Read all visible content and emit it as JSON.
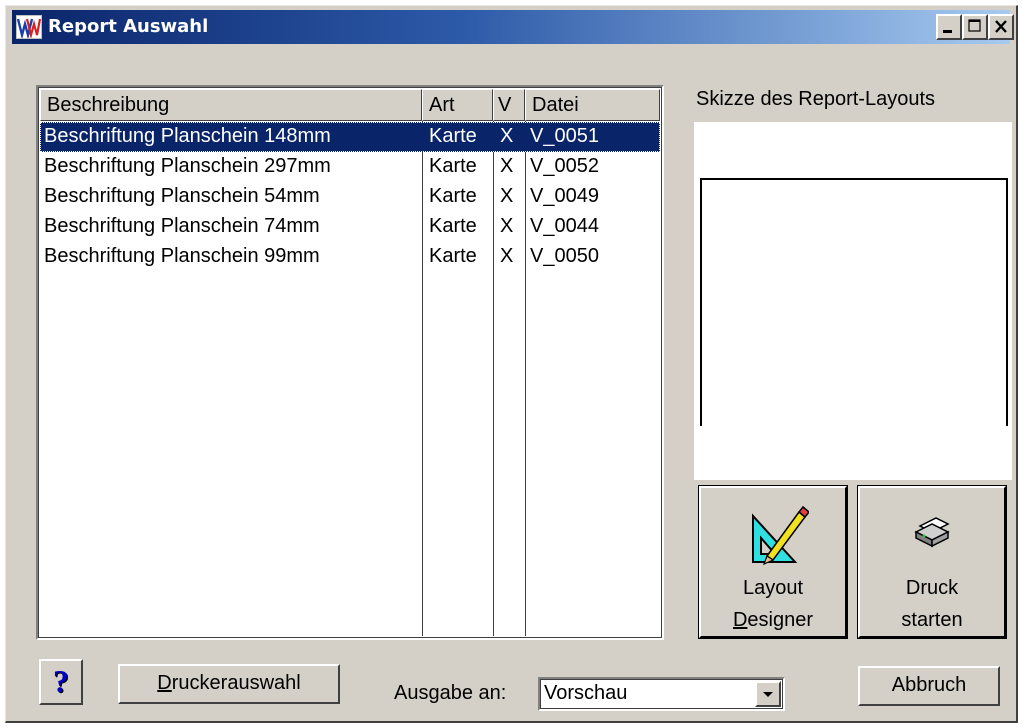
{
  "window": {
    "title": "Report Auswahl",
    "icon": "app-logo-icon",
    "controls": {
      "minimize": "minimize-icon",
      "maximize": "maximize-icon",
      "close": "close-icon"
    }
  },
  "report_list": {
    "columns": [
      "Beschreibung",
      "Art",
      "V",
      "Datei"
    ],
    "rows": [
      {
        "beschreibung": "Beschriftung Planschein 148mm",
        "art": "Karte",
        "v": "X",
        "datei": "V_0051",
        "selected": true
      },
      {
        "beschreibung": "Beschriftung Planschein 297mm",
        "art": "Karte",
        "v": "X",
        "datei": "V_0052",
        "selected": false
      },
      {
        "beschreibung": "Beschriftung Planschein 54mm",
        "art": "Karte",
        "v": "X",
        "datei": "V_0049",
        "selected": false
      },
      {
        "beschreibung": "Beschriftung Planschein 74mm",
        "art": "Karte",
        "v": "X",
        "datei": "V_0044",
        "selected": false
      },
      {
        "beschreibung": "Beschriftung Planschein 99mm",
        "art": "Karte",
        "v": "X",
        "datei": "V_0050",
        "selected": false
      }
    ],
    "selection_color": "#0a246a"
  },
  "sketch": {
    "label": "Skizze des Report-Layouts"
  },
  "buttons": {
    "layout_designer": {
      "line1": "Layout",
      "line2_accel": "D",
      "line2_rest": "esigner",
      "icon": "set-square-pencil-icon"
    },
    "druck_starten": {
      "line1": "Druck",
      "line2": "starten",
      "icon": "printer-icon"
    },
    "help": {
      "label": "?",
      "icon": "help-question-icon"
    },
    "druckerauswahl": {
      "accel": "D",
      "rest": "ruckerauswahl"
    },
    "abbruch": {
      "label": "Abbruch"
    }
  },
  "output": {
    "label": "Ausgabe an:",
    "selected": "Vorschau",
    "icon": "dropdown-arrow-icon"
  },
  "colors": {
    "face": "#d4d0c8",
    "title_start": "#0a246a",
    "title_end": "#a6caf0"
  }
}
